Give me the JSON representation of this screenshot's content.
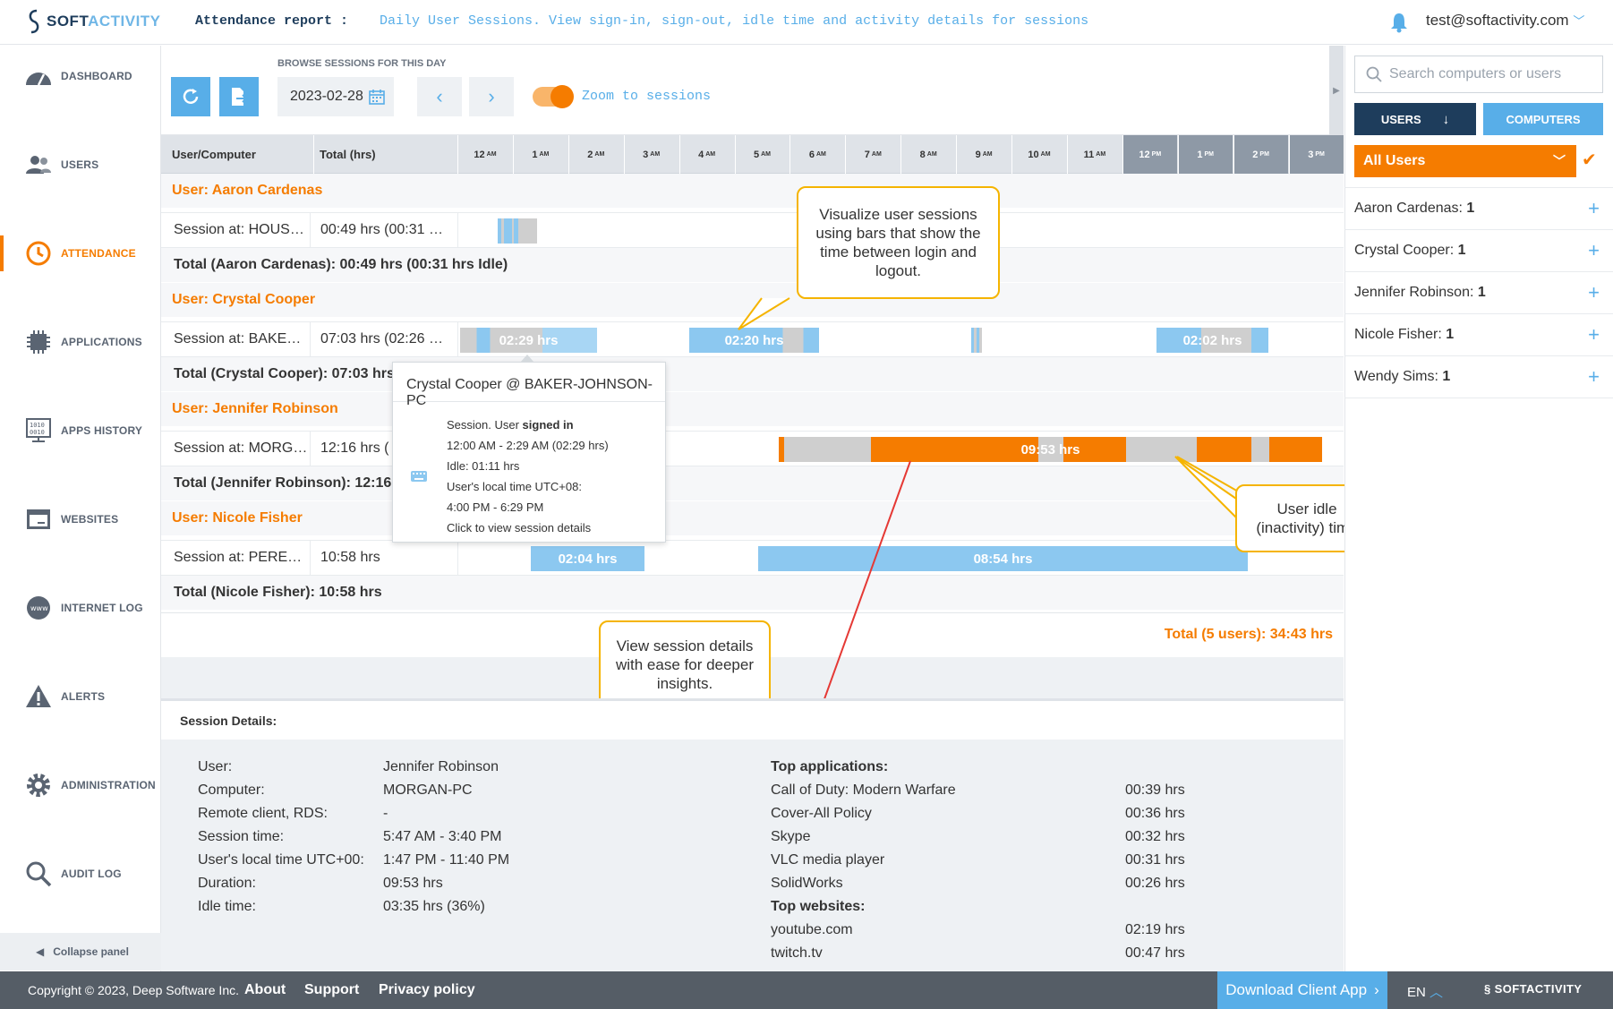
{
  "header": {
    "logo_soft": "SOFT",
    "logo_activity": "ACTIVITY",
    "report_title": "Attendance report :",
    "report_subtitle": "Daily User Sessions. View sign-in, sign-out, idle time and activity details for sessions",
    "user_email": "test@softactivity.com"
  },
  "sidebar": {
    "items": [
      {
        "label": "DASHBOARD",
        "icon": "dashboard-icon"
      },
      {
        "label": "USERS",
        "icon": "users-icon"
      },
      {
        "label": "ATTENDANCE",
        "icon": "attendance-icon",
        "active": true
      },
      {
        "label": "APPLICATIONS",
        "icon": "applications-icon"
      },
      {
        "label": "APPS HISTORY",
        "icon": "apps-history-icon"
      },
      {
        "label": "WEBSITES",
        "icon": "websites-icon"
      },
      {
        "label": "INTERNET LOG",
        "icon": "internet-log-icon"
      },
      {
        "label": "ALERTS",
        "icon": "alerts-icon"
      },
      {
        "label": "ADMINISTRATION",
        "icon": "administration-icon"
      },
      {
        "label": "AUDIT LOG",
        "icon": "audit-log-icon"
      }
    ],
    "collapse_label": "Collapse panel"
  },
  "toolbar": {
    "browse_label": "BROWSE SESSIONS FOR THIS DAY",
    "date": "2023-02-28",
    "zoom_label": "Zoom to sessions",
    "zoom_on": true
  },
  "grid": {
    "col_user": "User/Computer",
    "col_total": "Total (hrs)",
    "hours": [
      {
        "h": "12",
        "m": "AM"
      },
      {
        "h": "1",
        "m": "AM"
      },
      {
        "h": "2",
        "m": "AM"
      },
      {
        "h": "3",
        "m": "AM"
      },
      {
        "h": "4",
        "m": "AM"
      },
      {
        "h": "5",
        "m": "AM"
      },
      {
        "h": "6",
        "m": "AM"
      },
      {
        "h": "7",
        "m": "AM"
      },
      {
        "h": "8",
        "m": "AM"
      },
      {
        "h": "9",
        "m": "AM"
      },
      {
        "h": "10",
        "m": "AM"
      },
      {
        "h": "11",
        "m": "AM"
      },
      {
        "h": "12",
        "m": "PM"
      },
      {
        "h": "1",
        "m": "PM"
      },
      {
        "h": "2",
        "m": "PM"
      },
      {
        "h": "3",
        "m": "PM"
      }
    ],
    "users": [
      {
        "user_label": "User: Aaron Cardenas",
        "session_label": "Session at: HOUS…",
        "session_total": "00:49 hrs  (00:31 …",
        "total_label": "Total (Aaron Cardenas): 00:49 hrs (00:31 hrs Idle)"
      },
      {
        "user_label": "User: Crystal Cooper",
        "session_label": "Session at: BAKE…",
        "session_total": "07:03 hrs  (02:26 …",
        "total_label": "Total (Crystal Cooper): 07:03 hrs",
        "bar_labels": [
          "02:29 hrs",
          "02:20 hrs",
          "02:02 hrs"
        ]
      },
      {
        "user_label": "User: Jennifer Robinson",
        "session_label": "Session at: MORG…",
        "session_total": "12:16 hrs  (",
        "total_label": "Total (Jennifer Robinson): 12:16",
        "bar_labels": [
          "09:53 hrs"
        ]
      },
      {
        "user_label": "User: Nicole Fisher",
        "session_label": "Session at: PERE…",
        "session_total": "10:58 hrs",
        "total_label": "Total (Nicole Fisher): 10:58 hrs",
        "bar_labels": [
          "02:04 hrs",
          "08:54 hrs"
        ]
      }
    ],
    "grand_total": "Total (5 users): 34:43 hrs"
  },
  "tooltip": {
    "title": "Crystal Cooper @ BAKER-JOHNSON-PC",
    "line1_a": "Session. User ",
    "line1_b": "signed in",
    "line2": "12:00 AM - 2:29 AM (02:29 hrs)",
    "line3": "Idle: 01:11 hrs",
    "line4": "User's local time UTC+08:",
    "line5": "4:00 PM - 6:29 PM",
    "line6": "Click to view session details"
  },
  "callouts": {
    "bars": "Visualize user sessions using bars that show the time between login and logout.",
    "idle": "User idle (inactivity) time",
    "details": "View session details with ease for deeper insights."
  },
  "details": {
    "heading": "Session Details:",
    "fields": [
      {
        "k": "User:",
        "v": "Jennifer Robinson"
      },
      {
        "k": "Computer:",
        "v": "MORGAN-PC"
      },
      {
        "k": "Remote client, RDS:",
        "v": "-"
      },
      {
        "k": "Session time:",
        "v": "5:47 AM - 3:40 PM"
      },
      {
        "k": "User's local time UTC+00:",
        "v": "1:47 PM - 11:40 PM"
      },
      {
        "k": "Duration:",
        "v": "09:53 hrs"
      },
      {
        "k": "Idle time:",
        "v": "03:35 hrs (36%)"
      }
    ],
    "apps_heading": "Top applications:",
    "apps": [
      {
        "k": "Call of Duty: Modern Warfare",
        "v": "00:39 hrs"
      },
      {
        "k": "Cover-All Policy",
        "v": "00:36 hrs"
      },
      {
        "k": "Skype",
        "v": "00:32 hrs"
      },
      {
        "k": "VLC media player",
        "v": "00:31 hrs"
      },
      {
        "k": "SolidWorks",
        "v": "00:26 hrs"
      }
    ],
    "web_heading": "Top websites:",
    "websites": [
      {
        "k": "youtube.com",
        "v": "02:19 hrs"
      },
      {
        "k": "twitch.tv",
        "v": "00:47 hrs"
      }
    ]
  },
  "right_panel": {
    "search_placeholder": "Search computers or users",
    "btn_users": "USERS",
    "btn_computers": "COMPUTERS",
    "filter": "All Users",
    "users": [
      {
        "name": "Aaron Cardenas:",
        "count": "1"
      },
      {
        "name": "Crystal Cooper:",
        "count": "1"
      },
      {
        "name": "Jennifer Robinson:",
        "count": "1"
      },
      {
        "name": "Nicole Fisher:",
        "count": "1"
      },
      {
        "name": "Wendy Sims:",
        "count": "1"
      }
    ]
  },
  "footer": {
    "copyright": "Copyright © 2023, Deep Software Inc.",
    "about": "About",
    "support": "Support",
    "privacy": "Privacy policy",
    "download": "Download Client App",
    "lang": "EN",
    "logo": "SOFTACTIVITY"
  },
  "colors": {
    "orange": "#f57c00",
    "blue": "#58aee8",
    "navy": "#1e3d5c",
    "idle_gray": "#cfcfcf",
    "callout_border": "#f5b400",
    "arrow_red": "#e53935"
  }
}
